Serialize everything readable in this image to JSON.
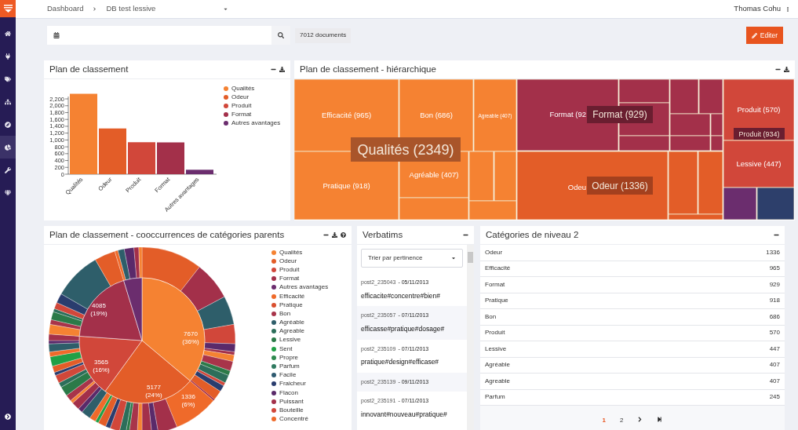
{
  "sidebar": {
    "items": [
      {
        "selected": false
      },
      {
        "selected": false
      },
      {
        "selected": false
      },
      {
        "selected": false
      },
      {
        "selected": false
      },
      {
        "selected": true
      },
      {
        "selected": false
      },
      {
        "selected": false
      }
    ]
  },
  "breadcrumb": [
    "Dashboard",
    "DB test lessive"
  ],
  "user": "Thomas Cohu",
  "search": {
    "count": "7012 documents",
    "edit_button": "Editer"
  },
  "bar_panel": {
    "title": "Plan de classement",
    "chart_data": {
      "type": "bar",
      "ylim": [
        0,
        2400
      ],
      "categories": [
        "Qualités",
        "Odeur",
        "Produit",
        "Format",
        "Autres avantages"
      ],
      "values": [
        2349,
        1336,
        934,
        929,
        130
      ],
      "yticks": [
        {
          "value": 0,
          "label": "0"
        },
        {
          "value": 200,
          "label": "200"
        },
        {
          "value": 400,
          "label": "400"
        },
        {
          "value": 600,
          "label": "600"
        },
        {
          "value": 800,
          "label": "800"
        },
        {
          "value": 1000,
          "label": "1,000"
        },
        {
          "value": 1200,
          "label": "1,200"
        },
        {
          "value": 1400,
          "label": "1,400"
        },
        {
          "value": 1600,
          "label": "1,600"
        },
        {
          "value": 1800,
          "label": "1,800"
        },
        {
          "value": 2000,
          "label": "2,000"
        },
        {
          "value": 2200,
          "label": "2,200"
        }
      ]
    },
    "legend": [
      {
        "label": "Qualités",
        "color": "#f58232"
      },
      {
        "label": "Odeur",
        "color": "#e35d28"
      },
      {
        "label": "Produit",
        "color": "#d1473a"
      },
      {
        "label": "Format",
        "color": "#a3304a"
      },
      {
        "label": "Autres avantages",
        "color": "#6b2d6e"
      }
    ]
  },
  "treemap_panel": {
    "title": "Plan de classement - hiérarchique",
    "cells": [
      {
        "label": "Efficacité (965)",
        "color": "#f58232"
      },
      {
        "label": "Bon (686)",
        "color": "#f58232"
      },
      {
        "label": "Agreable (407)",
        "color": "#f58232"
      },
      {
        "label": "Pratique (918)",
        "color": "#f58232"
      },
      {
        "label": "Agréable (407)",
        "color": "#f58232"
      },
      {
        "color": "#f58232"
      },
      {
        "color": "#f58232"
      },
      {
        "color": "#f58232"
      },
      {
        "color": "#f58232"
      },
      {
        "label": "Format (92",
        "color": "#a3304a"
      },
      {
        "color": "#a3304a"
      },
      {
        "color": "#a3304a"
      },
      {
        "color": "#a3304a"
      },
      {
        "color": "#a3304a"
      },
      {
        "color": "#a3304a"
      },
      {
        "color": "#a3304a"
      },
      {
        "color": "#a3304a"
      },
      {
        "color": "#a3304a"
      },
      {
        "color": "#a3304a"
      },
      {
        "label": "Odeu",
        "color": "#e35d28"
      },
      {
        "color": "#e35d28"
      },
      {
        "color": "#e35d28"
      },
      {
        "color": "#e35d28"
      },
      {
        "label": "Produit (570)",
        "color": "#d1473a"
      },
      {
        "label": "Lessive (447)",
        "color": "#d1473a"
      },
      {
        "color": "#6b2d6e"
      },
      {
        "color": "#2d3f6b"
      }
    ],
    "overlays": [
      "Qualités (2349)",
      "Format (929)",
      "Odeur (1336)",
      "Produit (934)"
    ]
  },
  "sunburst_panel": {
    "title": "Plan de classement - cooccurrences de catégories parents",
    "slice_labels": [
      {
        "value": "7670",
        "percent": "(36%)"
      },
      {
        "value": "5177",
        "percent": "(24%)"
      },
      {
        "value": "3565",
        "percent": "(16%)"
      },
      {
        "value": "4085",
        "percent": "(19%)"
      },
      {
        "value": "1336",
        "percent": "(6%)"
      }
    ],
    "legend": [
      {
        "label": "Qualités",
        "color": "#f58232"
      },
      {
        "label": "Odeur",
        "color": "#e35d28"
      },
      {
        "label": "Produit",
        "color": "#d1473a"
      },
      {
        "label": "Format",
        "color": "#a3304a"
      },
      {
        "label": "Autres avantages",
        "color": "#6b2d6e"
      },
      {
        "label": "Efficacité",
        "color": "#ef6a2a"
      },
      {
        "label": "Pratique",
        "color": "#d9502f"
      },
      {
        "label": "Bon",
        "color": "#a8344a"
      },
      {
        "label": "Agréable",
        "color": "#2e5e6a"
      },
      {
        "label": "Agreable",
        "color": "#2c6e5a"
      },
      {
        "label": "Lessive",
        "color": "#2b7a48"
      },
      {
        "label": "Sent",
        "color": "#1fa046"
      },
      {
        "label": "Propre",
        "color": "#2e8a4e"
      },
      {
        "label": "Parfum",
        "color": "#2f7a60"
      },
      {
        "label": "Facile",
        "color": "#2e5a70"
      },
      {
        "label": "Fraicheur",
        "color": "#2a3d6e"
      },
      {
        "label": "Flacon",
        "color": "#5a2a6a"
      },
      {
        "label": "Puissant",
        "color": "#a3304a"
      },
      {
        "label": "Bouteille",
        "color": "#d1473a"
      },
      {
        "label": "Concentré",
        "color": "#ef6a2a"
      }
    ]
  },
  "verbatims": {
    "title": "Verbatims",
    "sort": "Trier par pertinence",
    "items": [
      {
        "id": "post2_235043",
        "date": "- 05/11/2013",
        "text": "efficacite#concentre#bien#"
      },
      {
        "id": "post2_235057",
        "date": "- 07/11/2013",
        "text": "efficasse#pratique#dosage#"
      },
      {
        "id": "post2_235109",
        "date": "- 07/11/2013",
        "text": "pratique#design#efficase#"
      },
      {
        "id": "post2_235139",
        "date": "- 09/11/2013"
      },
      {
        "id": "post2_235191",
        "date": "- 07/11/2013",
        "text": "innovant#nouveau#pratique#"
      }
    ]
  },
  "categories": {
    "title": "Catégories de niveau 2",
    "rows": [
      {
        "name": "Odeur",
        "count": "1336"
      },
      {
        "name": "Efficacité",
        "count": "965"
      },
      {
        "name": "Format",
        "count": "929"
      },
      {
        "name": "Pratique",
        "count": "918"
      },
      {
        "name": "Bon",
        "count": "686"
      },
      {
        "name": "Produit",
        "count": "570"
      },
      {
        "name": "Lessive",
        "count": "447"
      },
      {
        "name": "Agréable",
        "count": "407"
      },
      {
        "name": "Agreable",
        "count": "407"
      },
      {
        "name": "Parfum",
        "count": "245"
      }
    ],
    "pages": [
      {
        "label": "1",
        "selected": true
      },
      {
        "label": "2",
        "selected": false
      }
    ]
  }
}
